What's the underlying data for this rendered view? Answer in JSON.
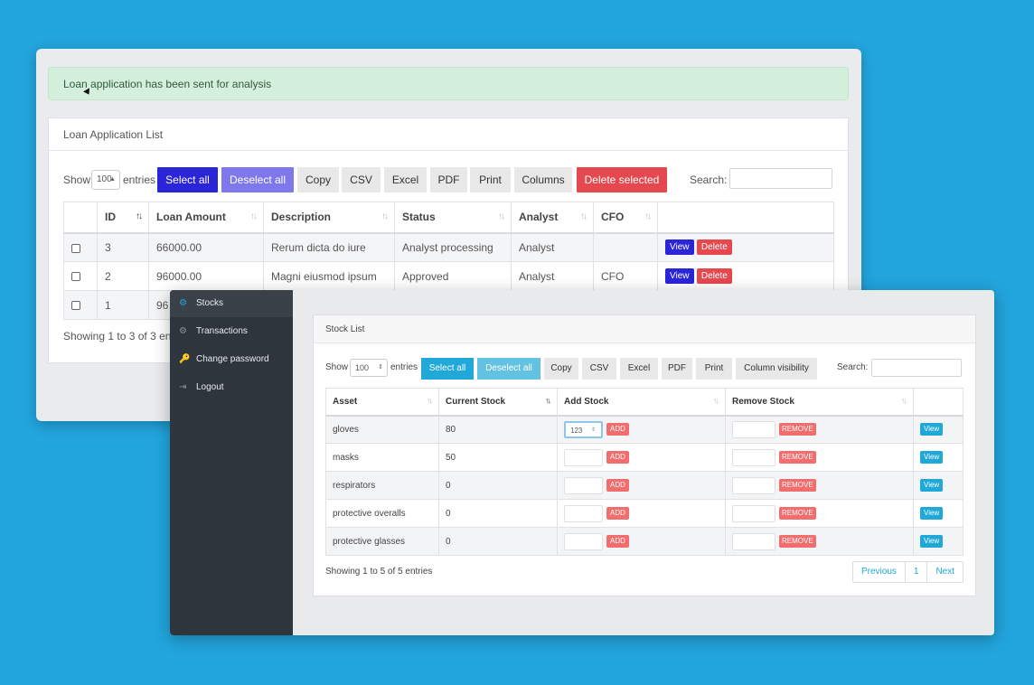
{
  "loan_window": {
    "alert": "Loan application has been sent for analysis",
    "card_title": "Loan Application List",
    "toolbar": {
      "show_label": "Show",
      "entries_value": "100",
      "entries_label": "entries",
      "buttons": [
        "Select all",
        "Deselect all",
        "Copy",
        "CSV",
        "Excel",
        "PDF",
        "Print",
        "Columns",
        "Delete selected"
      ],
      "search_label": "Search:"
    },
    "table": {
      "columns": [
        "",
        "ID",
        "Loan Amount",
        "Description",
        "Status",
        "Analyst",
        "CFO",
        ""
      ],
      "rows": [
        {
          "id": "3",
          "amount": "66000.00",
          "description": "Rerum dicta do iure",
          "status": "Analyst processing",
          "analyst": "Analyst",
          "cfo": "",
          "view": "View",
          "delete": "Delete"
        },
        {
          "id": "2",
          "amount": "96000.00",
          "description": "Magni eiusmod ipsum",
          "status": "Approved",
          "analyst": "Analyst",
          "cfo": "CFO",
          "view": "View",
          "delete": "Delete"
        },
        {
          "id": "1",
          "amount": "96",
          "description": "",
          "status": "",
          "analyst": "",
          "cfo": "",
          "view": "",
          "delete": ""
        }
      ]
    },
    "footer_info": "Showing 1 to 3 of 3 ent"
  },
  "stock_window": {
    "sidebar": [
      {
        "label": "Stocks",
        "icon": "gears-icon",
        "glyph": "⚙"
      },
      {
        "label": "Transactions",
        "icon": "gears-icon",
        "glyph": "⚙"
      },
      {
        "label": "Change password",
        "icon": "key-icon",
        "glyph": "🔑"
      },
      {
        "label": "Logout",
        "icon": "sign-out-icon",
        "glyph": "⇥"
      }
    ],
    "card_title": "Stock List",
    "toolbar": {
      "show_label": "Show",
      "entries_value": "100",
      "entries_label": "entries",
      "buttons": [
        "Select all",
        "Deselect all",
        "Copy",
        "CSV",
        "Excel",
        "PDF",
        "Print",
        "Column visibility"
      ],
      "search_label": "Search:"
    },
    "table": {
      "columns": [
        "Asset",
        "Current Stock",
        "Add Stock",
        "Remove Stock",
        ""
      ],
      "rows": [
        {
          "asset": "gloves",
          "stock": "80",
          "add_value": "123",
          "add": "ADD",
          "remove": "REMOVE",
          "view": "View"
        },
        {
          "asset": "masks",
          "stock": "50",
          "add_value": "",
          "add": "ADD",
          "remove": "REMOVE",
          "view": "View"
        },
        {
          "asset": "respirators",
          "stock": "0",
          "add_value": "",
          "add": "ADD",
          "remove": "REMOVE",
          "view": "View"
        },
        {
          "asset": "protective overalls",
          "stock": "0",
          "add_value": "",
          "add": "ADD",
          "remove": "REMOVE",
          "view": "View"
        },
        {
          "asset": "protective glasses",
          "stock": "0",
          "add_value": "",
          "add": "ADD",
          "remove": "REMOVE",
          "view": "View"
        }
      ]
    },
    "footer_info": "Showing 1 to 5 of 5 entries",
    "pagination": [
      "Previous",
      "1",
      "Next"
    ]
  },
  "colors": {
    "background": "#22a5dd",
    "loan_primary": "#2b25d8",
    "danger": "#e5484f",
    "stock_primary": "#20a8d8",
    "sidebar": "#2f353c",
    "alert_bg": "#d4f0dd"
  }
}
